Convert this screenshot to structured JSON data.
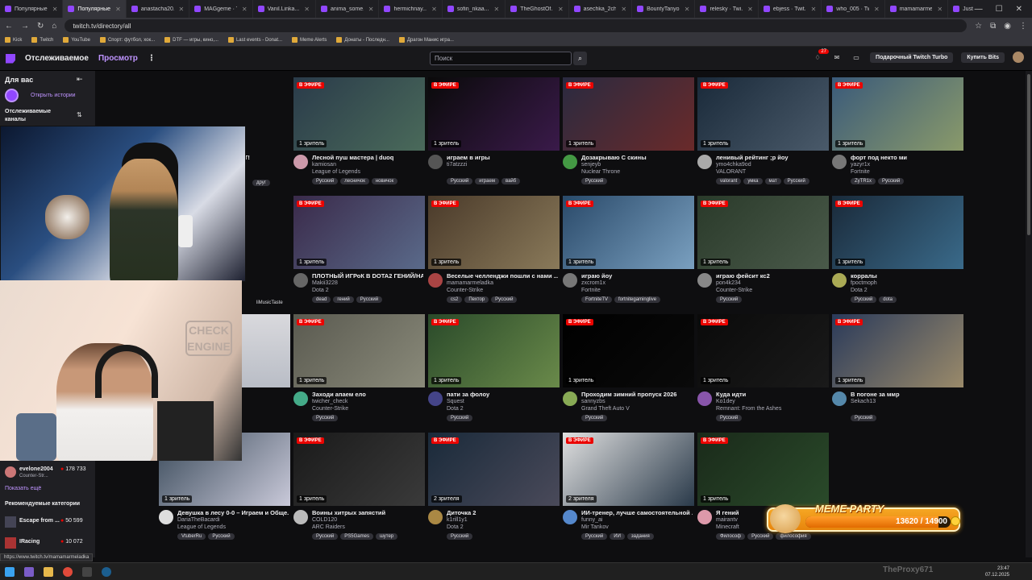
{
  "browser": {
    "tabs": [
      {
        "label": "Популярные..."
      },
      {
        "label": "Популярные...",
        "active": true
      },
      {
        "label": "anastacha20..."
      },
      {
        "label": "MAGgeme · T..."
      },
      {
        "label": "Vanil.Linka..."
      },
      {
        "label": "anima_some..."
      },
      {
        "label": "hermichnay..."
      },
      {
        "label": "sofin_nkaa..."
      },
      {
        "label": "TheGhostOf..."
      },
      {
        "label": "asechka_2ch..."
      },
      {
        "label": "BountyTanyo..."
      },
      {
        "label": "relesky · Twi..."
      },
      {
        "label": "ebjess · Twit..."
      },
      {
        "label": "who_005 · Tw..."
      },
      {
        "label": "mamamarme..."
      },
      {
        "label": "Just Chatting..."
      }
    ],
    "url": "twitch.tv/directory/all",
    "bookmarks": [
      "Kick",
      "Twitch",
      "YouTube",
      "Спорт: футбол, хок...",
      "DTF — игры, кино,...",
      "Last events - Donat...",
      "Meme Alerts",
      "Донаты - Последн...",
      "Драгон Манис игра..."
    ],
    "status_url": "https://www.twitch.tv/mamamarmeladka"
  },
  "twitch": {
    "following": "Отслеживаемое",
    "browse": "Просмотр",
    "search_placeholder": "Поиск",
    "notif_count": "27",
    "turbo": "Подарочный Twitch Turbo",
    "bits": "Купить Bits"
  },
  "sidebar": {
    "for_you": "Для вас",
    "open_stories": "Открыть истории",
    "followed": "Отслеживаемые каналы",
    "channel": {
      "name": "evelone2004",
      "game": "Counter-Str...",
      "viewers": "178 733"
    },
    "show_more": "Показать ещё",
    "recommended": "Рекомендуемые категории",
    "cats": [
      {
        "name": "Escape from ...",
        "viewers": "50 599"
      },
      {
        "name": "IRacing",
        "viewers": "10 072"
      }
    ]
  },
  "live_label": "В ЭФИРЕ",
  "streams": [
    {
      "title": "Лесной пуш мастера | duoq",
      "channel": "kamiosan",
      "category": "League of Legends",
      "tags": [
        "Русский",
        "лесничок",
        "новичок"
      ],
      "viewers": "1 зритель"
    },
    {
      "title": "играем в игры",
      "channel": "ti7atzzzi",
      "category": "",
      "tags": [
        "Русский",
        "играем",
        "вайб"
      ],
      "viewers": "1 зритель"
    },
    {
      "title": "Дозакрываю С скины",
      "channel": "senjeyb",
      "category": "Nuclear Throne",
      "tags": [
        "Русский"
      ],
      "viewers": "1 зритель"
    },
    {
      "title": "ленивый рейтинг ;р йоу",
      "channel": "ymo4chka9od",
      "category": "VALORANT",
      "tags": [
        "valorant",
        "умка",
        "мат",
        "Русский"
      ],
      "viewers": "1 зритель"
    },
    {
      "title": "форт под некто ми",
      "channel": "yazyr1x",
      "category": "Fortnite",
      "tags": [
        "ZyTR1x",
        "Русский"
      ],
      "viewers": "1 зритель"
    },
    {
      "title": "ПЛОТНЫЙ ИГРоК В DOTA2 ГЕНИЙ/НА...",
      "channel": "Makii3228",
      "category": "Dota 2",
      "tags": [
        "dead",
        "гений",
        "Русский"
      ],
      "viewers": "1 зритель"
    },
    {
      "title": "Веселые челленджи пошли с нами ...",
      "channel": "mamamarmeladka",
      "category": "Counter-Strike",
      "tags": [
        "cs2",
        "Пехтор",
        "Русский"
      ],
      "viewers": "1 зритель"
    },
    {
      "title": "играю йоу",
      "channel": "zxcrom1x",
      "category": "Fortnite",
      "tags": [
        "FortniteTV",
        "fortnitegaminglive"
      ],
      "viewers": "1 зритель"
    },
    {
      "title": "играю фейсит кс2",
      "channel": "pon4k234",
      "category": "Counter-Strike",
      "tags": [
        "Русский"
      ],
      "viewers": "1 зритель"
    },
    {
      "title": "корралы",
      "channel": "fpoctmoph",
      "category": "Dota 2",
      "tags": [
        "Русский",
        "dota"
      ],
      "viewers": "1 зритель"
    },
    {
      "title": "Заходи апаем ело",
      "channel": "twicher_check",
      "category": "Counter-Strike",
      "tags": [
        "Русский"
      ],
      "viewers": "1 зритель"
    },
    {
      "title": "пати за фолоу",
      "channel": "Squest",
      "category": "Dota 2",
      "tags": [
        "Русский"
      ],
      "viewers": "1 зритель"
    },
    {
      "title": "Проходим зимний пропуск 2026",
      "channel": "sannyzbs",
      "category": "Grand Theft Auto V",
      "tags": [
        "Русский"
      ],
      "viewers": "1 зритель"
    },
    {
      "title": "Куда идти",
      "channel": "Ko1dey",
      "category": "Remnant: From the Ashes",
      "tags": [
        "Русский"
      ],
      "viewers": "1 зритель"
    },
    {
      "title": "В погоне за ммр",
      "channel": "Sekach13",
      "category": "",
      "tags": [
        "Русский"
      ],
      "viewers": "1 зритель"
    },
    {
      "title": "Воины хитрых запястий",
      "channel": "COLD120",
      "category": "ARC Raiders",
      "tags": [
        "Русский",
        "PS5Games",
        "шутер"
      ],
      "viewers": "1 зритель"
    },
    {
      "title": "Диточка 2",
      "channel": "k1rill1y1",
      "category": "Dota 2",
      "tags": [
        "Русский"
      ],
      "viewers": "2 зрителя"
    },
    {
      "title": "ИИ-тренер, лучше самостоятельной ...",
      "channel": "funny_ai",
      "category": "Mir Tankov",
      "tags": [
        "Русский",
        "ИИ",
        "задания"
      ],
      "viewers": "2 зрителя"
    },
    {
      "title": "Я гений",
      "channel": "mairantv",
      "category": "Minecraft",
      "tags": [
        "Философ",
        "Русский",
        "философия"
      ],
      "viewers": "1 зритель"
    }
  ],
  "partial": {
    "row0_title": "ОТ!",
    "row0_tag": "друг",
    "row1_tag": "liMusicTaste",
    "row3_title": "Девушка в лесу 0-0 – Играем и Обще...",
    "row3_channel": "DariaTheBacardi",
    "row3_category": "League of Legends",
    "row3_tags": [
      "VtuberRu",
      "Русский"
    ],
    "row3_viewers": "1 зритель"
  },
  "overlay": {
    "title": "MEME PARTY",
    "progress": "13620 / 14900",
    "fraction": 0.914
  },
  "taskbar": {
    "time": "23:47",
    "date": "07.12.2025",
    "watermark": "TheProxy671"
  },
  "cam_text": "CHECK ENGINE"
}
